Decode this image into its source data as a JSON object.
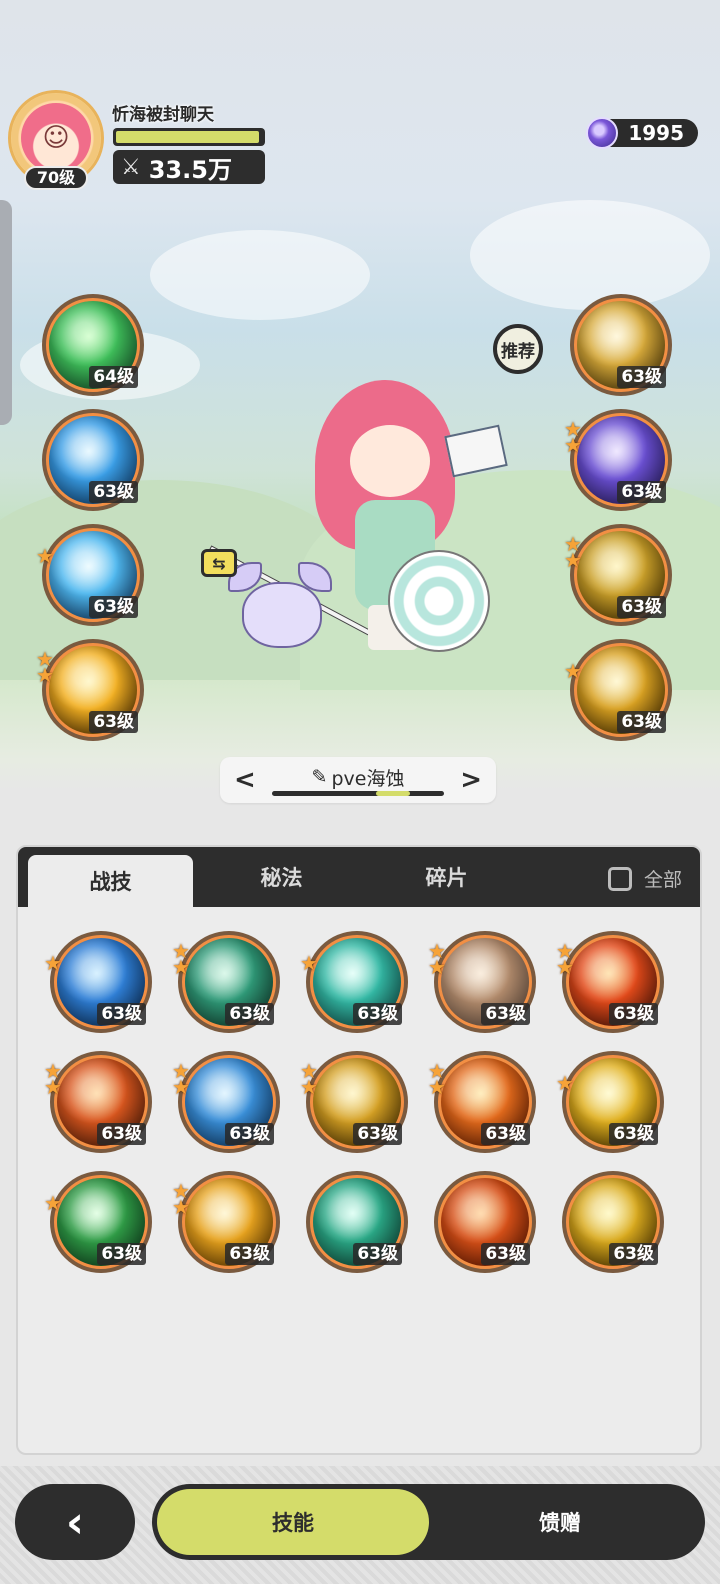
{
  "player": {
    "name": "忻海被封聊天",
    "level": "70级",
    "power": "33.5万",
    "exp_progress": 0.98
  },
  "currency": {
    "amount": "1995",
    "icon": "purple-gem-icon"
  },
  "recommend_label": "推荐",
  "equipped_left": [
    {
      "level": "64级",
      "stars": 0,
      "colors": [
        "#0f3b1f",
        "#3fbf5a",
        "#b8ffb0"
      ]
    },
    {
      "level": "63级",
      "stars": 0,
      "colors": [
        "#0b2c4d",
        "#3a9ee6",
        "#d8f4ff"
      ]
    },
    {
      "level": "63级",
      "stars": 1,
      "colors": [
        "#0c2a4a",
        "#4fb8ef",
        "#e0f8ff"
      ]
    },
    {
      "level": "63级",
      "stars": 2,
      "colors": [
        "#3a2200",
        "#f2b023",
        "#fff2a6"
      ]
    }
  ],
  "equipped_right": [
    {
      "level": "63级",
      "stars": 0,
      "colors": [
        "#3b2a05",
        "#d6a93a",
        "#fff2c2"
      ]
    },
    {
      "level": "63级",
      "stars": 2,
      "colors": [
        "#1e1646",
        "#6a4fd2",
        "#e3d6ff"
      ]
    },
    {
      "level": "63级",
      "stars": 2,
      "colors": [
        "#3a2800",
        "#caa02a",
        "#fff0a0"
      ]
    },
    {
      "level": "63级",
      "stars": 1,
      "colors": [
        "#3b2600",
        "#d8a122",
        "#fff3b3"
      ]
    }
  ],
  "preset": {
    "name": "pve海蚀",
    "prev": "<",
    "next": ">"
  },
  "panel": {
    "tabs": [
      "战技",
      "秘法",
      "碎片"
    ],
    "active_tab": "战技",
    "filter_label": "全部"
  },
  "skills": [
    {
      "level": "63级",
      "stars": 1,
      "colors": [
        "#08213f",
        "#2f7fd6",
        "#b8e6ff"
      ]
    },
    {
      "level": "63级",
      "stars": 2,
      "colors": [
        "#0d2e22",
        "#2f9a78",
        "#bff3da"
      ]
    },
    {
      "level": "63级",
      "stars": 1,
      "colors": [
        "#0d3a36",
        "#33b8a4",
        "#d3fff4"
      ]
    },
    {
      "level": "63级",
      "stars": 2,
      "colors": [
        "#4a3a30",
        "#b28b6c",
        "#f6e0c4"
      ]
    },
    {
      "level": "63级",
      "stars": 2,
      "colors": [
        "#3a0f05",
        "#e24a1a",
        "#ffd07a"
      ]
    },
    {
      "level": "63级",
      "stars": 2,
      "colors": [
        "#3a1405",
        "#d8561e",
        "#ffc87a"
      ]
    },
    {
      "level": "63级",
      "stars": 2,
      "colors": [
        "#0b2a4a",
        "#3a8fd8",
        "#cdeeff"
      ]
    },
    {
      "level": "63级",
      "stars": 2,
      "colors": [
        "#3a2600",
        "#d4a024",
        "#fff0a8"
      ]
    },
    {
      "level": "63级",
      "stars": 2,
      "colors": [
        "#4a1500",
        "#e26a1c",
        "#ffe08a"
      ]
    },
    {
      "level": "63级",
      "stars": 1,
      "colors": [
        "#3d2a00",
        "#e0b020",
        "#fff7b0"
      ]
    },
    {
      "level": "63级",
      "stars": 1,
      "colors": [
        "#0b2e16",
        "#2f9c46",
        "#cfffd2"
      ]
    },
    {
      "level": "63级",
      "stars": 2,
      "colors": [
        "#4a2c00",
        "#e6a21e",
        "#fff1b8"
      ]
    },
    {
      "level": "63级",
      "stars": 0,
      "colors": [
        "#0c3328",
        "#2aa886",
        "#caffee"
      ]
    },
    {
      "level": "63级",
      "stars": 0,
      "colors": [
        "#4a1200",
        "#d65018",
        "#ffc070"
      ]
    },
    {
      "level": "63级",
      "stars": 0,
      "colors": [
        "#3e2a00",
        "#d9aa1e",
        "#fff5a0"
      ]
    }
  ],
  "bottom_nav": {
    "back": "‹",
    "tabs": [
      "技能",
      "馈赠"
    ],
    "active": "技能"
  },
  "colors": {
    "accent": "#d4dc6a",
    "dark": "#2d2d2d",
    "skill_ring": "#f28f44",
    "star": "#f6a338"
  }
}
